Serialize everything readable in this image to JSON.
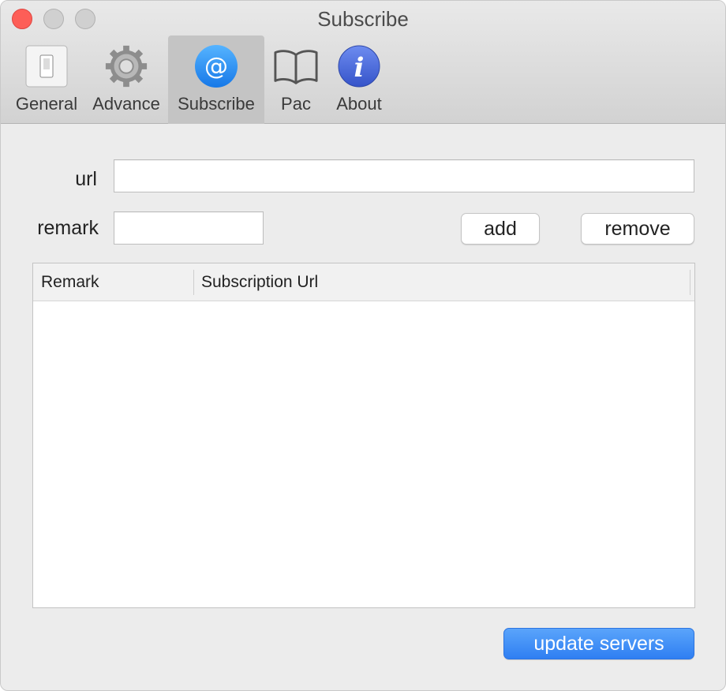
{
  "window": {
    "title": "Subscribe"
  },
  "toolbar": {
    "tabs": [
      {
        "label": "General",
        "icon": "switch-icon"
      },
      {
        "label": "Advance",
        "icon": "gear-icon"
      },
      {
        "label": "Subscribe",
        "icon": "at-sign-icon",
        "selected": true
      },
      {
        "label": "Pac",
        "icon": "book-icon"
      },
      {
        "label": "About",
        "icon": "info-icon"
      }
    ]
  },
  "form": {
    "url_label": "url",
    "url_value": "",
    "remark_label": "remark",
    "remark_value": "",
    "add_label": "add",
    "remove_label": "remove"
  },
  "table": {
    "columns": [
      "Remark",
      "Subscription Url"
    ],
    "rows": []
  },
  "footer": {
    "update_label": "update servers"
  },
  "colors": {
    "accent": "#2f7ff2",
    "close": "#fd5e57",
    "selected_tab": "#c4c4c4"
  }
}
